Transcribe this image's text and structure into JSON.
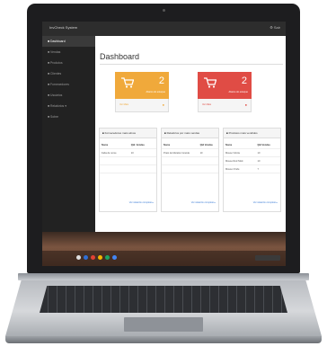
{
  "app": {
    "brand": "InvCheck System",
    "top_right": "⚙ Sair"
  },
  "sidebar": {
    "items": [
      {
        "label": "■ Dashboard"
      },
      {
        "label": "■ Vendas"
      },
      {
        "label": "■ Produtos"
      },
      {
        "label": "■ Clientes"
      },
      {
        "label": "■ Fornecedores"
      },
      {
        "label": "■ Usuários"
      },
      {
        "label": "■ Relatórios ▾"
      },
      {
        "label": "■ Sobre"
      }
    ]
  },
  "page": {
    "title": "Dashboard"
  },
  "tiles": [
    {
      "count": "2",
      "label": "Abaixo do estoque",
      "link": "Ver Mais",
      "color": "#f0a93b"
    },
    {
      "count": "2",
      "label": "Abaixo do estoque",
      "link": "Ver Mais",
      "color": "#e04c45"
    }
  ],
  "panels": [
    {
      "title": "■ Fornecedores mais ativos",
      "headers": [
        "Nome",
        "Qtd. Vendas"
      ],
      "rows": [
        [
          "Falta de nome",
          "10"
        ],
        [
          "",
          ""
        ],
        [
          "",
          ""
        ],
        [
          "",
          ""
        ]
      ],
      "link": "Ver relatório completo ▸"
    },
    {
      "title": "■ Relatórios por mais vendas",
      "headers": [
        "Nome",
        "Qtd Vendas"
      ],
      "rows": [
        [
          "Prato de Metalon Grande",
          "10"
        ],
        [
          "",
          ""
        ],
        [
          "",
          ""
        ],
        [
          "",
          ""
        ]
      ],
      "link": "Ver relatório completo ▸"
    },
    {
      "title": "■ Produtos mais vendidos",
      "headers": [
        "Nome",
        "Qtd Vendas"
      ],
      "rows": [
        [
          "Mouse Vitrola",
          "10"
        ],
        [
          "Mouse Red Stick",
          "10"
        ],
        [
          "Mouse Chefe",
          "7"
        ],
        [
          "",
          ""
        ]
      ],
      "link": "Ver relatório completo ▸"
    }
  ],
  "shelf": {
    "app_colors": [
      "#e0e0e0",
      "#2f6fd6",
      "#e34234",
      "#f5b400",
      "#1da462",
      "#4285f4"
    ]
  }
}
